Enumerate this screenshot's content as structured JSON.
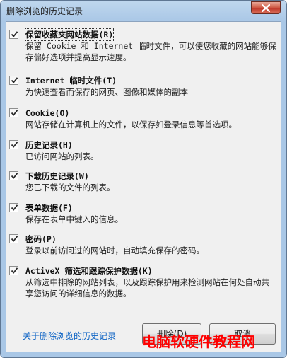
{
  "window": {
    "title": "删除浏览的历史记录"
  },
  "options": [
    {
      "label": "保留收藏夹网站数据(R)",
      "description": "保留 Cookie 和 Internet 临时文件，可以使您收藏的网站能够保存偏好选项并提高显示速度。",
      "checked": true
    },
    {
      "label": "Internet 临时文件(T)",
      "description": "为快速查看而保存的网页、图像和媒体的副本",
      "checked": true
    },
    {
      "label": "Cookie(O)",
      "description": "网站存储在计算机上的文件，以保存如登录信息等首选项。",
      "checked": true
    },
    {
      "label": "历史记录(H)",
      "description": "已访问网站的列表。",
      "checked": true
    },
    {
      "label": "下载历史记录(W)",
      "description": "您已下载的文件的列表。",
      "checked": true
    },
    {
      "label": "表单数据(F)",
      "description": "保存在表单中键入的信息。",
      "checked": true
    },
    {
      "label": "密码(P)",
      "description": "登录以前访问过的网站时，自动填充保存的密码。",
      "checked": true
    },
    {
      "label": "ActiveX 筛选和跟踪保护数据(K)",
      "description": "从筛选中排除的网站列表，以及跟踪保护用来检测网站在何处自动共享您访问的详细信息的数据。",
      "checked": true
    }
  ],
  "footer": {
    "help_link": "关于删除浏览的历史记录",
    "delete_label": "删除(D)",
    "cancel_label": "取消"
  },
  "watermark": "电脑软硬件教程网",
  "colors": {
    "frame": "#a9c7e6",
    "client": "#f0f0f0",
    "link": "#0b62c4",
    "close": "#c0392b",
    "watermark": "#ff0000"
  }
}
